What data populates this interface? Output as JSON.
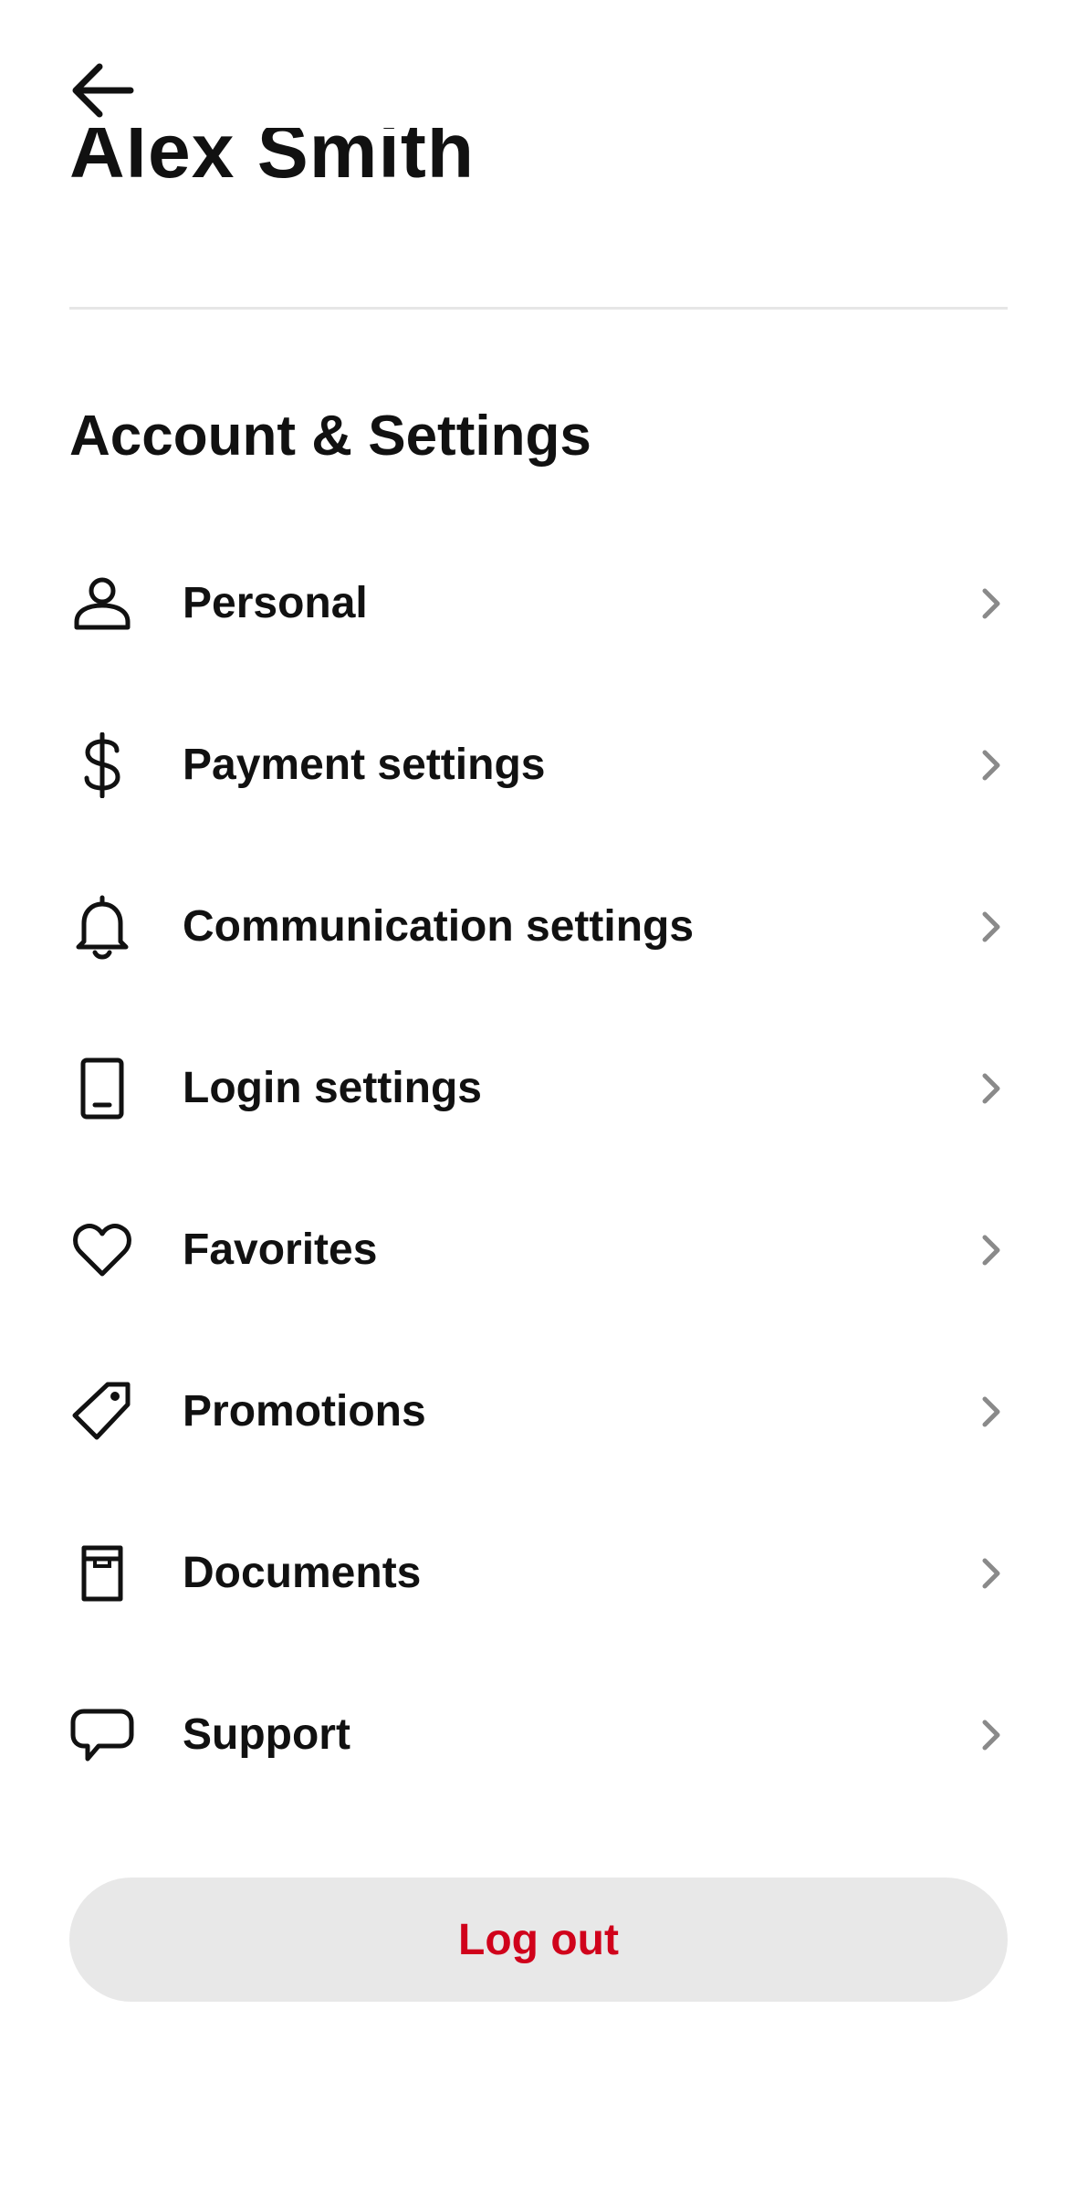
{
  "header": {
    "back_icon": "arrow-left-icon",
    "profile_name": "Alex  Smith"
  },
  "section": {
    "title": "Account & Settings"
  },
  "menu": {
    "items": [
      {
        "label": "Personal",
        "icon": "person-icon"
      },
      {
        "label": "Payment settings",
        "icon": "dollar-icon"
      },
      {
        "label": "Communication settings",
        "icon": "bell-icon"
      },
      {
        "label": "Login settings",
        "icon": "phone-icon"
      },
      {
        "label": "Favorites",
        "icon": "heart-icon"
      },
      {
        "label": "Promotions",
        "icon": "tag-icon"
      },
      {
        "label": "Documents",
        "icon": "document-icon"
      },
      {
        "label": "Support",
        "icon": "chat-bubble-icon"
      }
    ],
    "chevron_icon": "chevron-right-icon"
  },
  "logout": {
    "label": "Log out"
  },
  "colors": {
    "text": "#111111",
    "chevron": "#8a8a8a",
    "divider": "#e6e6e6",
    "logout_bg": "#e8e8e8",
    "logout_text": "#d0021b"
  }
}
